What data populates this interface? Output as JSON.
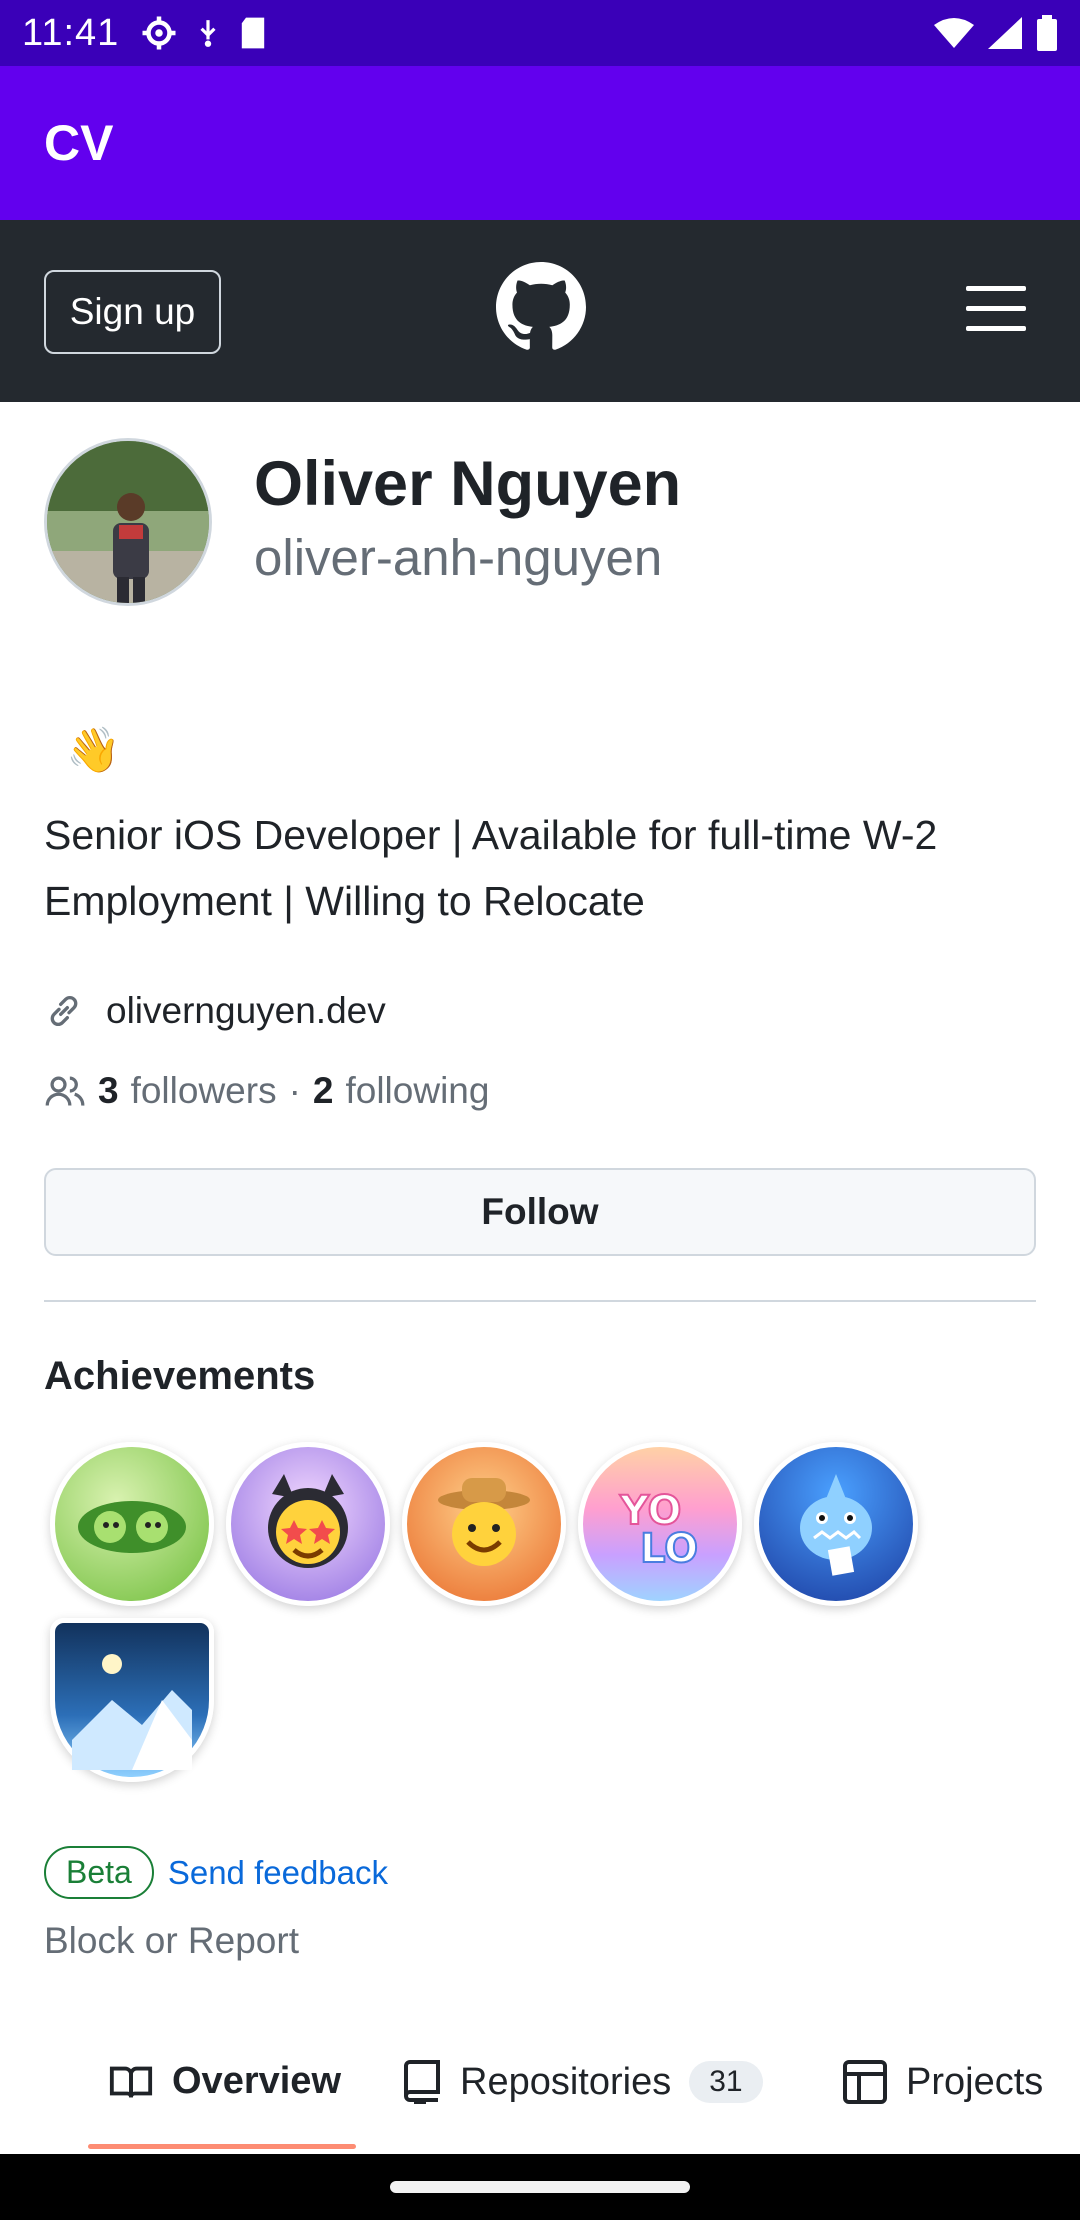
{
  "status_bar": {
    "time": "11:41"
  },
  "app_bar": {
    "title": "CV"
  },
  "header": {
    "signup_label": "Sign up"
  },
  "profile": {
    "name": "Oliver Nguyen",
    "login": "oliver-anh-nguyen",
    "status_emoji": "👋",
    "bio": "Senior iOS Developer | Available for full-time W-2 Employment | Willing to Relocate",
    "website": "olivernguyen.dev",
    "followers_count": "3",
    "followers_label": "followers",
    "separator": "·",
    "following_count": "2",
    "following_label": "following",
    "follow_label": "Follow"
  },
  "achievements": {
    "title": "Achievements",
    "badges": [
      {
        "name": "pea-pod-badge",
        "emoji": "🫛",
        "bg": "#9ed36a"
      },
      {
        "name": "starstruck-badge",
        "emoji": "🤩",
        "bg": "#c9a8f0"
      },
      {
        "name": "cowboy-badge",
        "emoji": "🤠",
        "bg": "#f5a03c"
      },
      {
        "name": "yolo-badge",
        "emoji": "YOLO",
        "bg": "#f4b3d6"
      },
      {
        "name": "shark-badge",
        "emoji": "🦈",
        "bg": "#2e5bd6"
      },
      {
        "name": "arctic-badge",
        "emoji": "🏔",
        "bg": "#2c7fc2"
      }
    ]
  },
  "feedback": {
    "beta_label": "Beta",
    "send_label": "Send feedback",
    "block_label": "Block or Report"
  },
  "tabs": [
    {
      "label": "Overview"
    },
    {
      "label": "Repositories",
      "count": "31"
    },
    {
      "label": "Projects"
    }
  ]
}
